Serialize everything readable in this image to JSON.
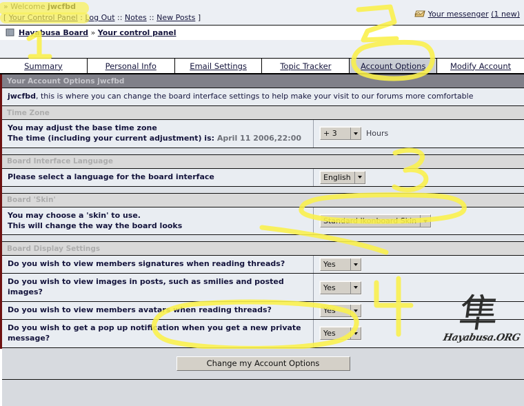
{
  "topbar": {
    "welcome_prefix": "» Welcome ",
    "username": "jwcfbd",
    "bracket_open": "[ ",
    "bracket_close": " ]",
    "links": [
      {
        "label": "Your Control Panel"
      },
      {
        "label": "Log Out"
      },
      {
        "label": "Notes"
      },
      {
        "label": "New Posts"
      }
    ],
    "sep_first": " : ",
    "sep": " :: ",
    "messenger_label": "Your messenger",
    "messenger_count": "(1 new)",
    "messenger_icon": "envelope-icon"
  },
  "breadcrumb": {
    "icon": "book-icon",
    "home": "Hayabusa Board",
    "separator": "»",
    "current": "Your control panel"
  },
  "tabs": [
    {
      "label": "Summary",
      "active": false
    },
    {
      "label": "Personal Info",
      "active": false
    },
    {
      "label": "Email Settings",
      "active": false
    },
    {
      "label": "Topic Tracker",
      "active": false
    },
    {
      "label": "Account Options",
      "active": true
    },
    {
      "label": "Modify Account",
      "active": false
    }
  ],
  "panel": {
    "title": "Your Account Options jwcfbd",
    "intro_user": "jwcfbd",
    "intro_rest": ", this is where you can change the board interface settings to help make your visit to our forums more comfortable"
  },
  "sections": {
    "timezone": {
      "header": "Time Zone",
      "label_line1": "You may adjust the base time zone",
      "label_line2": "The time (including your current adjustment) is:",
      "current_time": "April 11 2006,22:00",
      "select_value": "+ 3",
      "units": "Hours"
    },
    "language": {
      "header": "Board Interface Language",
      "label": "Please select a language for the board interface",
      "select_value": "English"
    },
    "skin": {
      "header": "Board 'Skin'",
      "label_line1": "You may choose a 'skin' to use.",
      "label_line2": "This will change the way the board looks",
      "select_value": "Standard Ikonboard Skin"
    },
    "display": {
      "header": "Board Display Settings",
      "rows": [
        {
          "label": "Do you wish to view members signatures when reading threads?",
          "value": "Yes"
        },
        {
          "label": "Do you wish to view images in posts, such as smilies and posted images?",
          "value": "Yes"
        },
        {
          "label": "Do you wish to view members avatars when reading threads?",
          "value": "Yes"
        },
        {
          "label": "Do you wish to get a pop up notification when you get a new private message?",
          "value": "Yes"
        }
      ]
    }
  },
  "submit": {
    "label": "Change my Account Options"
  },
  "watermark": {
    "kanji": "隼",
    "wordmark": "Hayabusa.ORG"
  },
  "annotations": {
    "marker_color": "#fbf14a",
    "steps": [
      {
        "number": "1",
        "target": "Your Control Panel link"
      },
      {
        "number": "2",
        "target": "Account Options tab"
      },
      {
        "number": "3",
        "target": "Board skin selector"
      },
      {
        "number": "4",
        "target": "Change my Account Options button"
      }
    ]
  }
}
